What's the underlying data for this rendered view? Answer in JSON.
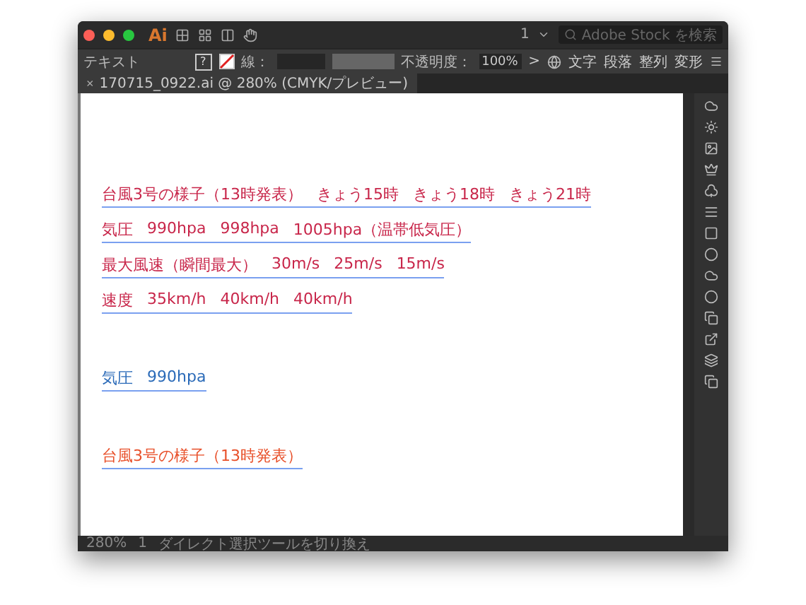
{
  "title_bar": {
    "logo": "Ai",
    "arrangement": "1",
    "search_placeholder": "Adobe Stock を検索"
  },
  "control_bar": {
    "selection": "テキスト",
    "fill_label": "?",
    "stroke_label": "線：",
    "opacity_label": "不透明度：",
    "opacity_value": "100%",
    "more": ">",
    "panel_links": [
      "文字",
      "段落",
      "整列",
      "変形"
    ]
  },
  "document_tab": {
    "close": "×",
    "title": "170715_0922.ai @ 280% (CMYK/プレビュー)"
  },
  "canvas": {
    "blocks": [
      {
        "color": "#c8264a",
        "rows": [
          [
            "台風3号の様子（13時発表）",
            "きょう15時",
            "きょう18時",
            "きょう21時"
          ],
          [
            "気圧",
            "990hpa",
            "998hpa",
            "1005hpa（温帯低気圧）"
          ],
          [
            "最大風速（瞬間最大）",
            "30m/s",
            "25m/s",
            "15m/s"
          ],
          [
            "速度",
            "35km/h",
            "40km/h",
            "40km/h"
          ]
        ]
      },
      {
        "color": "#2a6ab8",
        "rows": [
          [
            "気圧",
            "990hpa"
          ]
        ]
      },
      {
        "color": "#e8502a",
        "rows": [
          [
            "台風3号の様子（13時発表）"
          ]
        ]
      }
    ]
  },
  "status_bar": {
    "zoom": "280%",
    "artboard": "1",
    "tool_hint": "ダイレクト選択ツールを切り換え"
  }
}
